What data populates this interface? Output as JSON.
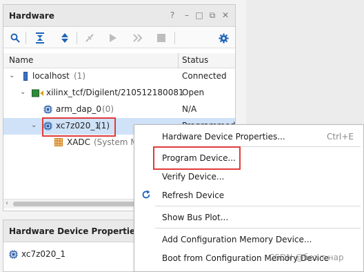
{
  "hardware_panel": {
    "title": "Hardware",
    "controls": [
      "?",
      "–",
      "□",
      "⧉",
      "✕"
    ],
    "toolbar": [
      "search-icon",
      "collapse-all-icon",
      "expand-all-icon",
      "auto-connect-icon",
      "run-icon",
      "step-icon",
      "stop-icon",
      "gear-icon"
    ],
    "columns": {
      "name": "Name",
      "status": "Status"
    },
    "rows": [
      {
        "name": "localhost",
        "count": "(1)",
        "status": "Connected"
      },
      {
        "name": "xilinx_tcf/Digilent/210512180081",
        "count": "",
        "status": "Open"
      },
      {
        "name": "arm_dap_0",
        "count": "(0)",
        "status": "N/A"
      },
      {
        "name": "xc7z020_1",
        "count": "(1)",
        "status": "Programmed"
      },
      {
        "name": "XADC",
        "count": "(System Mo",
        "status": ""
      }
    ]
  },
  "properties_panel": {
    "title": "Hardware Device Properties",
    "item": "xc7z020_1"
  },
  "context_menu": {
    "items": [
      {
        "label": "Hardware Device Properties...",
        "shortcut": "Ctrl+E"
      },
      {
        "label": "Program Device..."
      },
      {
        "label": "Verify Device..."
      },
      {
        "label": "Refresh Device"
      },
      {
        "label": "Show Bus Plot..."
      },
      {
        "label": "Add Configuration Memory Device..."
      },
      {
        "label": "Boot from Configuration Memory Device"
      }
    ]
  },
  "watermark": "CSDN @без т.нар",
  "colors": {
    "selection": "#cfe2f7",
    "highlight": "#e03a3a",
    "toolbar_blue": "#1c63b7"
  }
}
